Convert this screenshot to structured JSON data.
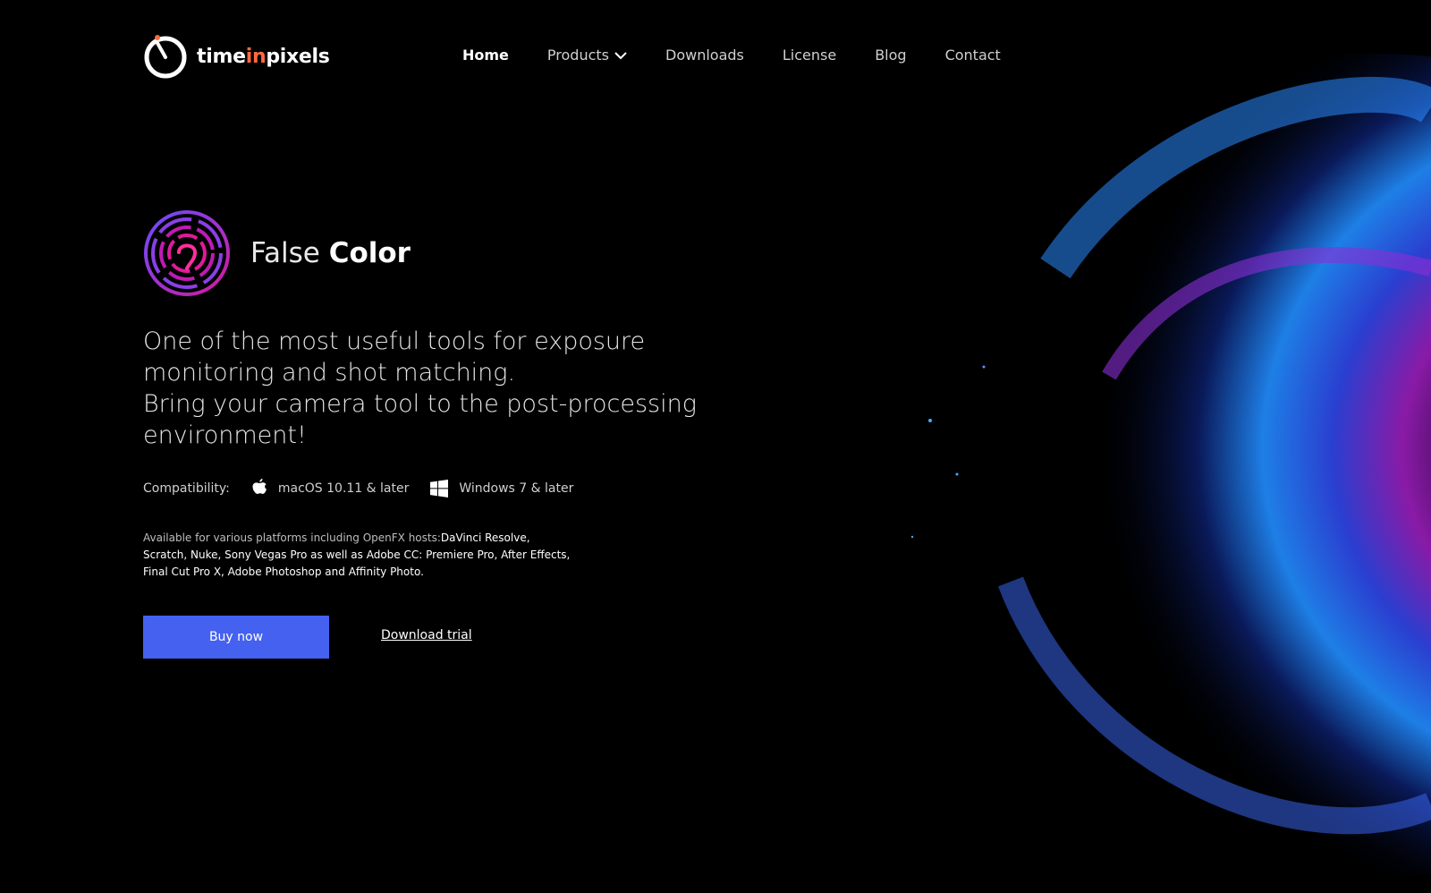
{
  "brand": {
    "name_part1": "time",
    "name_part2": "in",
    "name_part3": "pixels",
    "accent_color": "#ff6a3d"
  },
  "nav": {
    "home": "Home",
    "products": "Products",
    "downloads": "Downloads",
    "license": "License",
    "blog": "Blog",
    "contact": "Contact"
  },
  "product": {
    "name_light": "False",
    "name_bold": "Color",
    "icon": "fingerprint-icon"
  },
  "hero": {
    "line1": "One of the most useful tools for exposure",
    "line2": "monitoring and shot matching.",
    "line3": "Bring your camera tool to the post-processing",
    "line4": "environment!"
  },
  "compatibility": {
    "label": "Compatibility:",
    "mac": "macOS 10.11 & later",
    "windows": "Windows 7 & later"
  },
  "available": {
    "intro": "Available for various platforms including OpenFX hosts:",
    "hosts": "DaVinci Resolve, Scratch, Nuke, Sony Vegas Pro as well as Adobe CC: Premiere Pro, After Effects, Final Cut Pro X, Adobe Photoshop and Affinity Photo."
  },
  "cta": {
    "buy": "Buy now",
    "trial": "Download trial",
    "buy_color": "#4561ef"
  }
}
